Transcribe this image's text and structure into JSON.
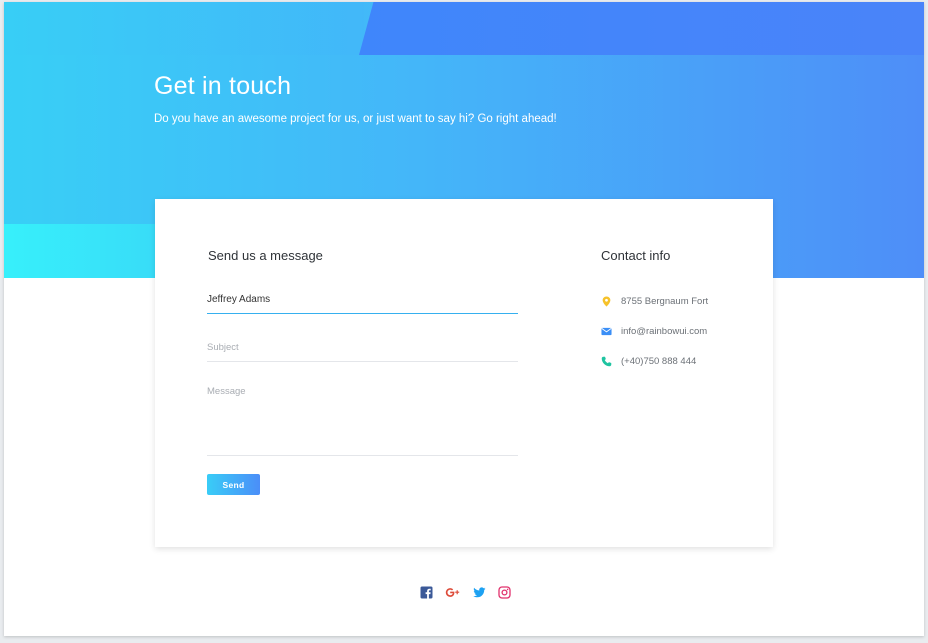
{
  "hero": {
    "title": "Get in touch",
    "subtitle": "Do you have an awesome project for us, or just want to say hi? Go right ahead!"
  },
  "form": {
    "heading": "Send us a message",
    "name_value": "Jeffrey Adams",
    "subject_placeholder": "Subject",
    "message_placeholder": "Message",
    "send_label": "Send"
  },
  "contact": {
    "heading": "Contact info",
    "address": "8755 Bergnaum Fort",
    "email": "info@rainbowui.com",
    "phone": "(+40)750 888 444",
    "icons": [
      "location-icon",
      "email-icon",
      "phone-icon"
    ]
  },
  "social": {
    "icons": [
      "facebook-icon",
      "google-plus-icon",
      "twitter-icon",
      "instagram-icon"
    ]
  },
  "colors": {
    "gradient_start": "#38cff6",
    "gradient_end": "#4e8ef8",
    "location": "#f6c22b",
    "email": "#3a8ef6",
    "phone": "#1fc4a1",
    "facebook": "#3b5998",
    "google_plus": "#dd4b39",
    "twitter": "#1da1f2",
    "instagram": "#e1306c"
  }
}
